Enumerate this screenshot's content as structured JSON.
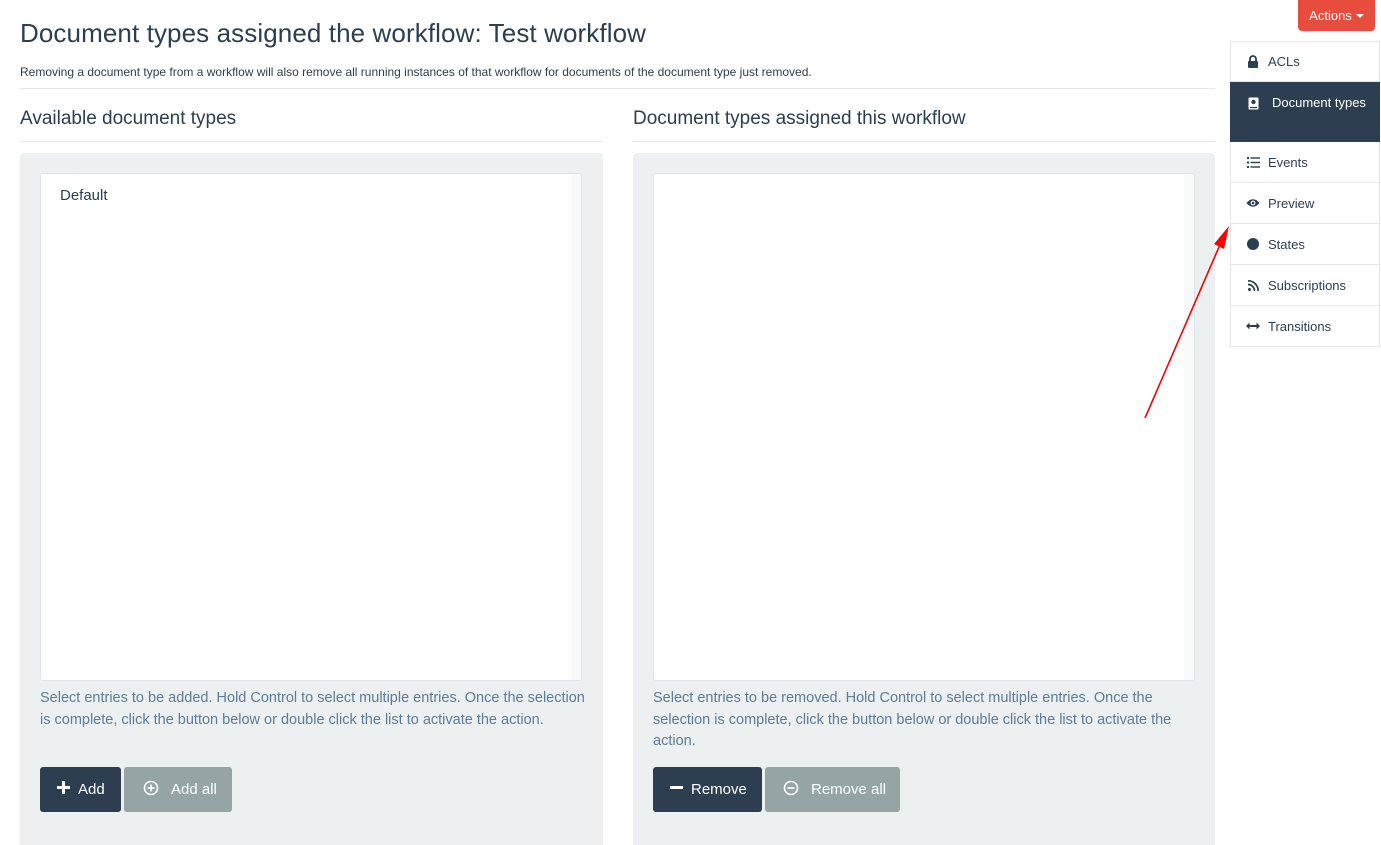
{
  "header": {
    "title": "Document types assigned the workflow: Test workflow",
    "subtitle": "Removing a document type from a workflow will also remove all running instances of that workflow for documents of the document type just removed.",
    "actions_label": "Actions"
  },
  "available": {
    "heading": "Available document types",
    "options": [
      "Default"
    ],
    "help": "Select entries to be added. Hold Control to select multiple entries. Once the selection is complete, click the button below or double click the list to activate the action.",
    "add_label": "Add",
    "add_all_label": "Add all"
  },
  "assigned": {
    "heading": "Document types assigned this workflow",
    "options": [],
    "help": "Select entries to be removed. Hold Control to select multiple entries. Once the selection is complete, click the button below or double click the list to activate the action.",
    "remove_label": "Remove",
    "remove_all_label": "Remove all"
  },
  "sidenav": {
    "items": [
      {
        "label": "ACLs",
        "icon": "lock-icon"
      },
      {
        "label": "Document types",
        "icon": "book-icon",
        "active": true
      },
      {
        "label": "Events",
        "icon": "list-icon"
      },
      {
        "label": "Preview",
        "icon": "eye-icon"
      },
      {
        "label": "States",
        "icon": "circle-icon"
      },
      {
        "label": "Subscriptions",
        "icon": "rss-icon"
      },
      {
        "label": "Transitions",
        "icon": "arrows-h-icon"
      }
    ]
  },
  "colors": {
    "primary_dark": "#2c3e50",
    "muted_button": "#95a5a6",
    "danger": "#e74c3c",
    "panel_bg": "#ecf0f1",
    "annotation_arrow": "#ff0000"
  }
}
